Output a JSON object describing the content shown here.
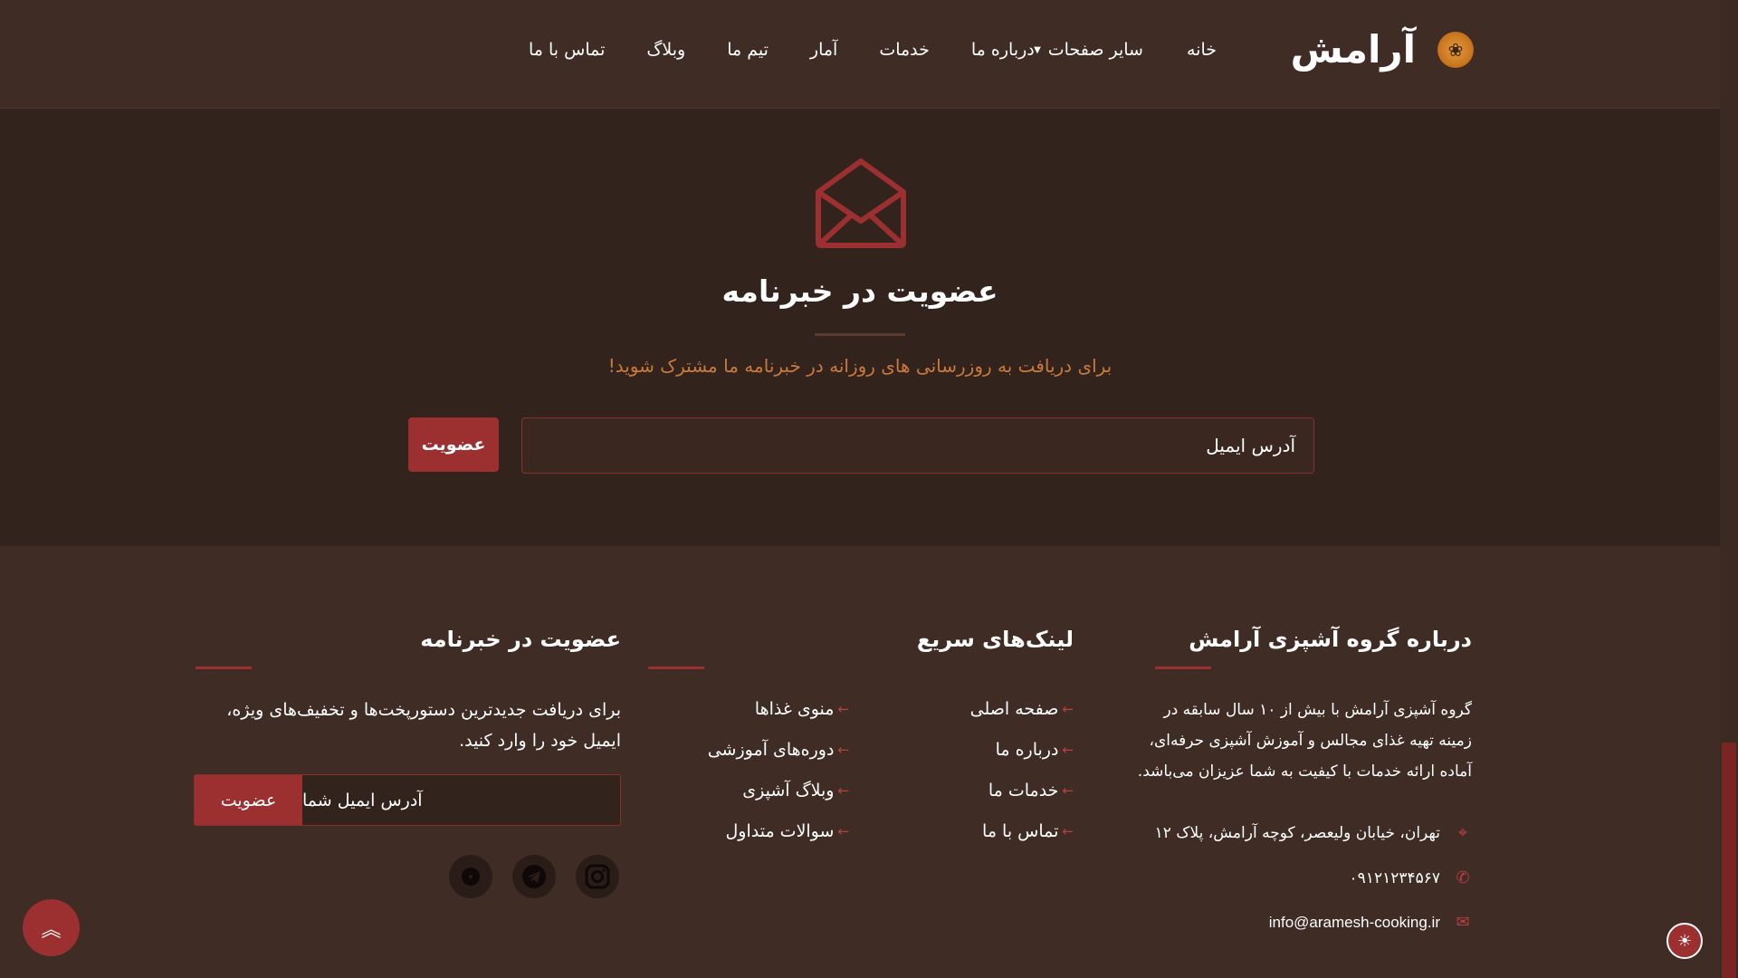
{
  "header": {
    "logo_text": "آرامش",
    "logo_icon": "wheat-icon",
    "nav": {
      "home": "خانه",
      "more_pages": "سایر صفحات",
      "about": "درباره ما",
      "services": "خدمات",
      "stats": "آمار",
      "team": "تیم ما",
      "blog": "وبلاگ",
      "contact": "تماس با ما"
    }
  },
  "hero": {
    "icon": "envelope-open-icon",
    "title": "عضویت در خبرنامه",
    "subtitle": "برای دریافت به روزرسانی های روزانه در خبرنامه ما مشترک شوید!",
    "email_placeholder": "آدرس ایمیل",
    "submit_label": "عضویت"
  },
  "footer": {
    "about": {
      "title": "درباره گروه آشپزی آرامش",
      "text": "گروه آشپزی آرامش با بیش از ۱۰ سال سابقه در زمینه تهیه غذای مجالس و آموزش آشپزی حرفه‌ای، آماده ارائه خدمات با کیفیت به شما عزیزان می‌باشد.",
      "address": "تهران، خیابان ولیعصر، کوچه آرامش، پلاک ۱۲",
      "phone": "۰۹۱۲۱۲۳۴۵۶۷",
      "email": "info@aramesh-cooking.ir"
    },
    "quick_links": {
      "title": "لینک‌های سریع",
      "col1": [
        "صفحه اصلی",
        "درباره ما",
        "خدمات ما",
        "تماس با ما"
      ],
      "col2": [
        "منوی غذاها",
        "دوره‌های آموزشی",
        "وبلاگ آشپزی",
        "سوالات متداول"
      ]
    },
    "newsletter": {
      "title": "عضویت در خبرنامه",
      "text": "برای دریافت جدیدترین دستورپخت‌ها و تخفیف‌های ویژه، ایمیل خود را وارد کنید.",
      "email_placeholder": "آدرس ایمیل شما",
      "submit_label": "عضویت"
    },
    "socials": [
      "instagram-icon",
      "telegram-icon",
      "aparat-icon"
    ]
  },
  "colors": {
    "background": "#3f2c24",
    "hero_background": "#32231d",
    "accent": "#9c2f2f",
    "subtitle": "#c97a3c"
  }
}
